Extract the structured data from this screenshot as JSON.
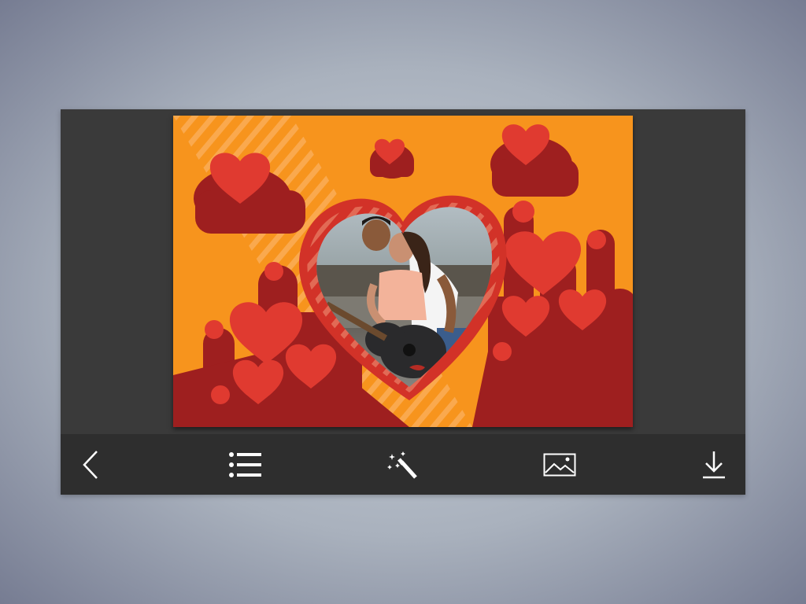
{
  "theme": {
    "background_color": "#a9b1bd",
    "panel_color": "#3a3a3a",
    "toolbar_color": "#2e2e2e",
    "icon_color": "#ffffff",
    "frame_orange": "#f7941d",
    "frame_dark_red": "#9e1f1f",
    "frame_heart_red": "#e03a30"
  },
  "editor": {
    "frame_style": "red-hearts-on-orange",
    "photo_shape": "heart"
  },
  "toolbar": {
    "buttons": [
      {
        "icon": "back-chevron-icon"
      },
      {
        "icon": "list-icon"
      },
      {
        "icon": "magic-wand-icon"
      },
      {
        "icon": "image-gallery-icon"
      },
      {
        "icon": "download-icon"
      }
    ]
  }
}
